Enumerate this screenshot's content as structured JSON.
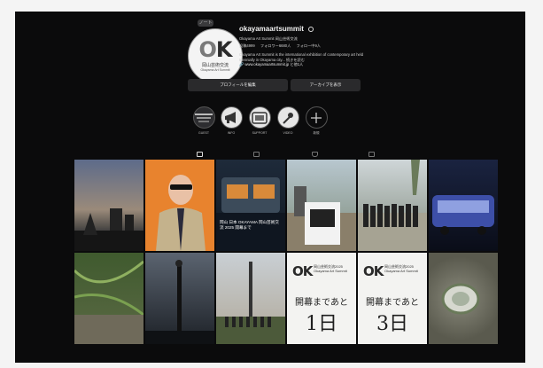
{
  "profile": {
    "username": "okayamaartsummit",
    "display_name": "Okayama Art Summit 岡山芸術交流",
    "stats": [
      "投稿4999",
      "フォロワー6680人",
      "フォロー中9人"
    ],
    "bio_line1": "Okayama Art Summit is the international exhibition of contemporary art held",
    "bio_line2": "triennially in Okayama city... 続きを読む",
    "link": "www.okayamaartsummit.jp と他1人",
    "avatar_logo": "OK",
    "avatar_ja": "岡山芸術交流",
    "avatar_en": "Okayama Art Summit",
    "note_badge": "ノート",
    "edit_button": "プロフィールを編集",
    "archive_button": "アーカイブを表示"
  },
  "highlights": [
    {
      "label": "GUEST",
      "icon": "guest-icon"
    },
    {
      "label": "INFO",
      "icon": "megaphone-icon"
    },
    {
      "label": "SUPPORT",
      "icon": "support-icon"
    },
    {
      "label": "VIDEO",
      "icon": "video-icon"
    },
    {
      "label": "新規",
      "icon": "plus-icon"
    }
  ],
  "tabs": [
    "grid-icon",
    "reels-icon",
    "saved-icon",
    "tagged-icon"
  ],
  "posts": {
    "row1_text": "岡山 日本 OKAYAMA 岡山芸術交流 2025 開幕まで",
    "countdown1_logo": "OK",
    "countdown1_sub1": "岡山芸術交流2025",
    "countdown1_sub2": "Okayama Art Summit",
    "countdown1_line1": "開幕まであと",
    "countdown1_line2": "1日",
    "countdown2_logo": "OK",
    "countdown2_sub1": "岡山芸術交流2025",
    "countdown2_sub2": "Okayama Art Summit",
    "countdown2_line1": "開幕まであと",
    "countdown2_line2": "3日"
  },
  "colors": {
    "background": "#0b0b0c",
    "button": "#2a2a2c",
    "text": "#f2f2f2"
  }
}
